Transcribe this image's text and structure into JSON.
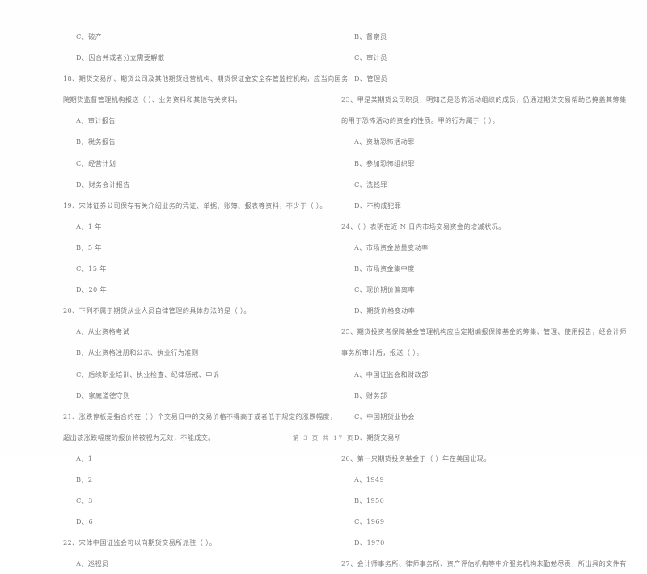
{
  "document": {
    "type": "exam-paper",
    "language": "zh-CN",
    "columns": 2
  },
  "footer": {
    "text": "第 3 页 共 17 页",
    "page_number": "3",
    "total_pages": "17"
  },
  "left_column": {
    "lines": [
      {
        "kind": "option",
        "text": "C、破产"
      },
      {
        "kind": "option",
        "text": "D、因合并或者分立需要解散"
      },
      {
        "kind": "question",
        "text": "18、期货交易所、期货公司及其他期货经营机构、期货保证金安全存管监控机构，应当向国务"
      },
      {
        "kind": "cont",
        "text": "院期货监督管理机构报送（      ）、业务资料和其他有关资料。"
      },
      {
        "kind": "option",
        "text": "A、审计报告"
      },
      {
        "kind": "option",
        "text": "B、税务报告"
      },
      {
        "kind": "option",
        "text": "C、经营计划"
      },
      {
        "kind": "option",
        "text": "D、财务会计报告"
      },
      {
        "kind": "question",
        "text": "19、宋体证券公司保存有关介绍业务的凭证、单据、账簿、报表等资料，不少于（      ）。"
      },
      {
        "kind": "option",
        "text": "A、1 年"
      },
      {
        "kind": "option",
        "text": "B、5 年"
      },
      {
        "kind": "option",
        "text": "C、15 年"
      },
      {
        "kind": "option",
        "text": "D、20 年"
      },
      {
        "kind": "question",
        "text": "20、下列不属于期货从业人员自律管理的具体办法的是（      ）。"
      },
      {
        "kind": "option",
        "text": "A、从业资格考试"
      },
      {
        "kind": "option",
        "text": "B、从业资格注册和公示、执业行为准则"
      },
      {
        "kind": "option",
        "text": "C、后续职业培训、执业检查、纪律惩戒、申诉"
      },
      {
        "kind": "option",
        "text": "D、家庭道德守则"
      },
      {
        "kind": "question",
        "text": "21、涨跌停板是指合约在（      ）个交易日中的交易价格不得高于或者低于规定的涨跌幅度，"
      },
      {
        "kind": "cont",
        "text": "超出该涨跌幅度的报价将被视为无效，不能成交。"
      },
      {
        "kind": "option",
        "text": "A、1"
      },
      {
        "kind": "option",
        "text": "B、2"
      },
      {
        "kind": "option",
        "text": "C、3"
      },
      {
        "kind": "option",
        "text": "D、6"
      },
      {
        "kind": "question",
        "text": "22、宋体中国证监会可以向期货交易所派驻（      ）。"
      },
      {
        "kind": "option",
        "text": "A、巡视员"
      }
    ]
  },
  "right_column": {
    "lines": [
      {
        "kind": "option",
        "text": "B、督察员"
      },
      {
        "kind": "option",
        "text": "C、审计员"
      },
      {
        "kind": "option",
        "text": "D、管理员"
      },
      {
        "kind": "question",
        "text": "23、甲是某期货公司职员，明知乙是恐怖活动组织的成员，仍通过期货交易帮助乙掩盖其筹集"
      },
      {
        "kind": "cont",
        "text": "的用于恐怖活动的资金的性质。甲的行为属于（      ）。"
      },
      {
        "kind": "option",
        "text": "A、资助恐怖活动罪"
      },
      {
        "kind": "option",
        "text": "B、参加恐怖组织罪"
      },
      {
        "kind": "option",
        "text": "C、洗钱罪"
      },
      {
        "kind": "option",
        "text": "D、不构成犯罪"
      },
      {
        "kind": "question",
        "text": "24、（      ）表明在近 N 日内市场交易资金的增减状况。"
      },
      {
        "kind": "option",
        "text": "A、市场资金总量变动率"
      },
      {
        "kind": "option",
        "text": "B、市场资金集中度"
      },
      {
        "kind": "option",
        "text": "C、现价期价偏离率"
      },
      {
        "kind": "option",
        "text": "D、期货价格变动率"
      },
      {
        "kind": "question",
        "text": "25、期货投资者保障基金管理机构应当定期编报保障基金的筹集、管理、使用报告，经会计师"
      },
      {
        "kind": "cont",
        "text": "事务所审计后，报送（      ）。"
      },
      {
        "kind": "option",
        "text": "A、中国证监会和财政部"
      },
      {
        "kind": "option",
        "text": "B、财务部"
      },
      {
        "kind": "option",
        "text": "C、中国期货业协会"
      },
      {
        "kind": "option",
        "text": "D、期货交易所"
      },
      {
        "kind": "question",
        "text": "26、第一只期货投资基金于（      ）年在美国出现。"
      },
      {
        "kind": "option",
        "text": "A、1949"
      },
      {
        "kind": "option",
        "text": "B、1950"
      },
      {
        "kind": "option",
        "text": "C、1969"
      },
      {
        "kind": "option",
        "text": "D、1970"
      },
      {
        "kind": "question",
        "text": "27、会计师事务所、律师事务所、资产评估机构等中介服务机构未勤勉尽责，所出具的文件有"
      }
    ]
  }
}
